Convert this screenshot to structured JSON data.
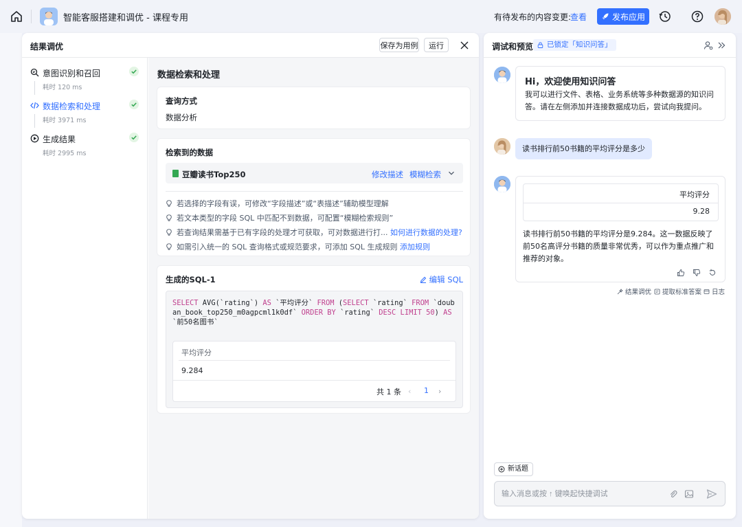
{
  "topbar": {
    "app_title": "智能客服搭建和调优 - 课程专用",
    "pending_text": "有待发布的内容变更:",
    "pending_link": "查看",
    "publish_label": "发布应用"
  },
  "left_panel": {
    "title": "结果调优",
    "save_example_label": "保存为用例",
    "run_label": "运行",
    "steps": [
      {
        "name": "意图识别和召回",
        "time": "耗时 120 ms",
        "icon": "search-doc-icon",
        "active": false
      },
      {
        "name": "数据检索和处理",
        "time": "耗时 3971 ms",
        "icon": "code-icon",
        "active": true
      },
      {
        "name": "生成结果",
        "time": "耗时 2995 ms",
        "icon": "play-circle-icon",
        "active": false
      }
    ],
    "main_title": "数据检索和处理",
    "query": {
      "label": "查询方式",
      "value": "数据分析"
    },
    "retrieved": {
      "label": "检索到的数据",
      "dataset_name": "豆瓣读书Top250",
      "modify_desc": "修改描述",
      "fuzzy_search": "模糊检索",
      "tips": [
        {
          "text": "若选择的字段有误，可修改“字段描述”或“表描述”辅助模型理解",
          "link": ""
        },
        {
          "text": "若文本类型的字段 SQL 中匹配不到数据，可配置“模糊检索规则”",
          "link": ""
        },
        {
          "text": "若查询结果需基于已有字段的处理才可获取，可对数据进行打...",
          "link": "如何进行数据的处理?"
        },
        {
          "text": "如需引入统一的 SQL 查询格式或规范要求，可添加 SQL 生成规则",
          "link": "添加规则"
        }
      ]
    },
    "sql": {
      "label": "生成的SQL-1",
      "edit_label": "编辑 SQL",
      "tokens": [
        {
          "t": "SELECT",
          "k": true
        },
        {
          "t": " AVG(`rating`) ",
          "k": false
        },
        {
          "t": "AS",
          "k": true
        },
        {
          "t": " `平均评分` ",
          "k": false
        },
        {
          "t": "FROM",
          "k": true
        },
        {
          "t": " (",
          "k": false
        },
        {
          "t": "SELECT",
          "k": true
        },
        {
          "t": " `rating` ",
          "k": false
        },
        {
          "t": "FROM",
          "k": true
        },
        {
          "t": " `douban_book_top250_m0agpcml1k0df` ",
          "k": false
        },
        {
          "t": "ORDER BY",
          "k": true
        },
        {
          "t": " `rating` ",
          "k": false
        },
        {
          "t": "DESC LIMIT",
          "k": true
        },
        {
          "t": " ",
          "k": false
        },
        {
          "t": "50",
          "k": true
        },
        {
          "t": ") ",
          "k": false
        },
        {
          "t": "AS",
          "k": true
        },
        {
          "t": " `前50名图书`",
          "k": false
        }
      ],
      "result": {
        "column": "平均评分",
        "value": "9.284",
        "total": "共 1 条",
        "page": "1"
      }
    }
  },
  "right_panel": {
    "title": "调试和预览",
    "lock_tag": "已锁定「知识问答」",
    "welcome_title": "Hi，欢迎使用知识问答",
    "welcome_body": "我可以进行文件、表格、业务系统等多种数据源的知识问答。请在左侧添加并连接数据成功后，尝试向我提问。",
    "user_question": "读书排行前50书籍的平均评分是多少",
    "answer": {
      "column": "平均评分",
      "value": "9.28",
      "text": "读书排行前50书籍的平均评分是9.284。这一数据反映了前50名高评分书籍的质量非常优秀，可以作为重点推广和推荐的对象。"
    },
    "actions": [
      "结果调优",
      "提取标准答案",
      "日志"
    ],
    "new_topic": "新话题",
    "input_placeholder": "输入消息或按 ↑ 键唤起快捷调试"
  },
  "colors": {
    "accent": "#3370ff",
    "success": "#34a853",
    "keyword": "#c0408e"
  }
}
